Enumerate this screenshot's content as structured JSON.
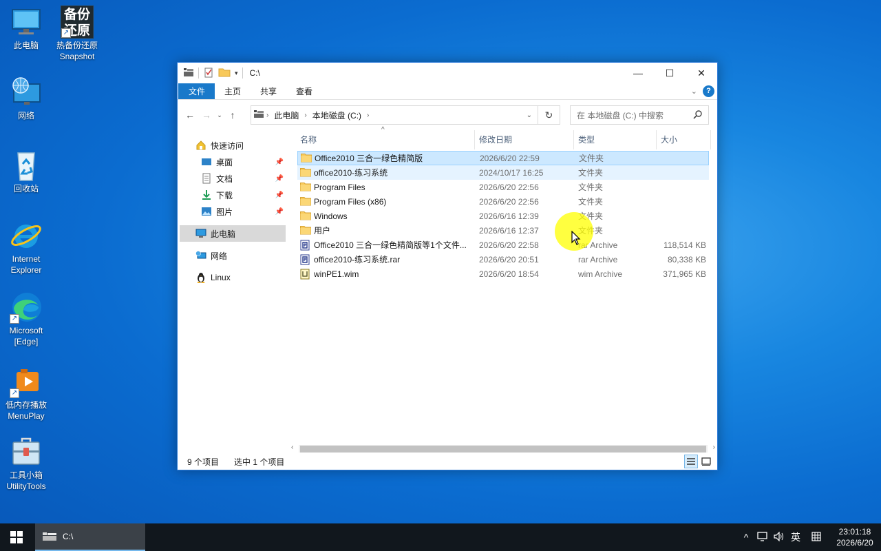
{
  "desktop": {
    "icons": [
      {
        "label": "此电脑",
        "label2": ""
      },
      {
        "label": "热备份还原",
        "label2": "Snapshot",
        "art": "备份还原"
      },
      {
        "label": "网络",
        "label2": ""
      },
      {
        "label": "回收站",
        "label2": ""
      },
      {
        "label": "Internet",
        "label2": "Explorer"
      },
      {
        "label": "Microsoft",
        "label2": "[Edge]"
      },
      {
        "label": "低内存播放",
        "label2": "MenuPlay"
      },
      {
        "label": "工具小箱",
        "label2": "UtilityTools"
      }
    ]
  },
  "window": {
    "title": "C:\\",
    "controls": {
      "minimize": "—",
      "maximize": "☐",
      "close": "✕"
    },
    "ribbon_tabs": [
      "文件",
      "主页",
      "共享",
      "查看"
    ],
    "address": {
      "crumbs": [
        "此电脑",
        "本地磁盘 (C:)"
      ]
    },
    "search_placeholder": "在 本地磁盘 (C:) 中搜索",
    "nav_pane": {
      "quick_access": "快速访问",
      "pinned": [
        "桌面",
        "文档",
        "下载",
        "图片"
      ],
      "this_pc": "此电脑",
      "network": "网络",
      "linux": "Linux"
    },
    "columns": {
      "name": "名称",
      "date": "修改日期",
      "type": "类型",
      "size": "大小"
    },
    "files": [
      {
        "name": "Office2010 三合一绿色精简版",
        "date": "2026/6/20 22:59",
        "type": "文件夹",
        "size": "",
        "icon": "folder-icon"
      },
      {
        "name": "office2010-练习系统",
        "date": "2024/10/17 16:25",
        "type": "文件夹",
        "size": "",
        "icon": "folder-icon"
      },
      {
        "name": "Program Files",
        "date": "2026/6/20 22:56",
        "type": "文件夹",
        "size": "",
        "icon": "folder-icon"
      },
      {
        "name": "Program Files (x86)",
        "date": "2026/6/20 22:56",
        "type": "文件夹",
        "size": "",
        "icon": "folder-icon"
      },
      {
        "name": "Windows",
        "date": "2026/6/16 12:39",
        "type": "文件夹",
        "size": "",
        "icon": "folder-icon"
      },
      {
        "name": "用户",
        "date": "2026/6/16 12:37",
        "type": "文件夹",
        "size": "",
        "icon": "folder-icon"
      },
      {
        "name": "Office2010 三合一绿色精简版等1个文件...",
        "date": "2026/6/20 22:58",
        "type": "rar Archive",
        "size": "118,514 KB",
        "icon": "archive-icon"
      },
      {
        "name": "office2010-练习系统.rar",
        "date": "2026/6/20 20:51",
        "type": "rar Archive",
        "size": "80,338 KB",
        "icon": "archive-icon"
      },
      {
        "name": "winPE1.wim",
        "date": "2026/6/20 18:54",
        "type": "wim Archive",
        "size": "371,965 KB",
        "icon": "wim-icon"
      }
    ],
    "status": {
      "count": "9 个项目",
      "selected": "选中 1 个项目"
    }
  },
  "taskbar": {
    "task_label": "C:\\",
    "tray": {
      "ime": "英",
      "time": "23:01:18",
      "date": "2026/6/20"
    }
  },
  "colors": {
    "accent": "#1979ca",
    "selection": "#cce8ff",
    "taskbar": "#11171d"
  }
}
